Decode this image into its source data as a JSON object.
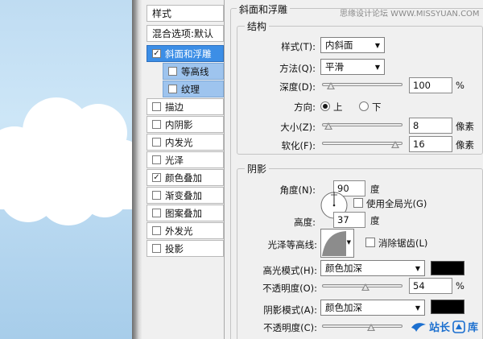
{
  "style_list": {
    "items": [
      {
        "label": "样式",
        "checkbox": false,
        "checked": false,
        "state": "header"
      },
      {
        "label": "混合选项:默认",
        "checkbox": false,
        "checked": false,
        "state": "header"
      },
      {
        "label": "斜面和浮雕",
        "checkbox": true,
        "checked": true,
        "state": "selected"
      },
      {
        "label": "等高线",
        "checkbox": true,
        "checked": false,
        "state": "sub"
      },
      {
        "label": "纹理",
        "checkbox": true,
        "checked": false,
        "state": "sub"
      },
      {
        "label": "描边",
        "checkbox": true,
        "checked": false,
        "state": "normal"
      },
      {
        "label": "内阴影",
        "checkbox": true,
        "checked": false,
        "state": "normal"
      },
      {
        "label": "内发光",
        "checkbox": true,
        "checked": false,
        "state": "normal"
      },
      {
        "label": "光泽",
        "checkbox": true,
        "checked": false,
        "state": "normal"
      },
      {
        "label": "颜色叠加",
        "checkbox": true,
        "checked": true,
        "state": "normal"
      },
      {
        "label": "渐变叠加",
        "checkbox": true,
        "checked": false,
        "state": "normal"
      },
      {
        "label": "图案叠加",
        "checkbox": true,
        "checked": false,
        "state": "normal"
      },
      {
        "label": "外发光",
        "checkbox": true,
        "checked": false,
        "state": "normal"
      },
      {
        "label": "投影",
        "checkbox": true,
        "checked": false,
        "state": "normal"
      }
    ]
  },
  "panel": {
    "section_title": "斜面和浮雕",
    "watermark": "思缘设计论坛 WWW.MISSYUAN.COM",
    "structure": {
      "title": "结构",
      "style_label": "样式(T):",
      "style_value": "内斜面",
      "technique_label": "方法(Q):",
      "technique_value": "平滑",
      "depth_label": "深度(D):",
      "depth_value": "100",
      "depth_unit": "%",
      "depth_slider": 0.07,
      "direction_label": "方向:",
      "direction_up": "上",
      "direction_down": "下",
      "size_label": "大小(Z):",
      "size_value": "8",
      "size_unit": "像素",
      "size_slider": 0.03,
      "soften_label": "软化(F):",
      "soften_value": "16",
      "soften_unit": "像素",
      "soften_slider": 0.95
    },
    "shading": {
      "title": "阴影",
      "angle_label": "角度(N):",
      "angle_value": "90",
      "angle_unit": "度",
      "global_light_label": "使用全局光(G)",
      "altitude_label": "高度:",
      "altitude_value": "37",
      "altitude_unit": "度",
      "gloss_label": "光泽等高线:",
      "antialias_label": "消除锯齿(L)",
      "highlight_label": "高光模式(H):",
      "highlight_value": "颜色加深",
      "highlight_color": "#000000",
      "highlight_opacity_label": "不透明度(O):",
      "highlight_opacity_value": "54",
      "highlight_opacity_unit": "%",
      "highlight_opacity_slider": 0.54,
      "shadow_label": "阴影模式(A):",
      "shadow_value": "颜色加深",
      "shadow_color": "#000000",
      "shadow_opacity_label": "不透明度(C):",
      "shadow_opacity_slider": 0.62
    }
  },
  "brand": {
    "text1": "站长",
    "text2": "库"
  }
}
